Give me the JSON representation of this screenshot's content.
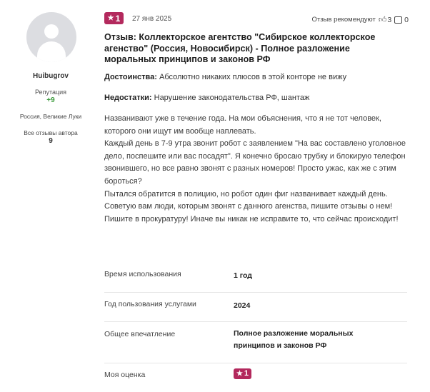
{
  "author": {
    "name": "Huibugrov",
    "reputation_label": "Репутация",
    "reputation_value": "+9",
    "location": "Россия, Великие Луки",
    "all_reviews_label": "Все отзывы автора",
    "all_reviews_count": "9"
  },
  "review": {
    "rating": "1",
    "date": "27 янв 2025",
    "recommend_label": "Отзыв рекомендуют",
    "likes": "3",
    "comments": "0",
    "title": "Отзыв: Коллекторское агентство \"Сибирское коллекторское агенство\" (Россия, Новосибирск) - Полное разложение моральных принципов и законов РФ",
    "pros_label": "Достоинства:",
    "pros_text": "Абсолютно никаких плюсов в этой конторе не вижу",
    "cons_label": "Недостатки:",
    "cons_text": "Нарушение законодательства РФ, шантаж",
    "paragraphs": [
      "Названивают уже в течение года. На мои объяснения, что я не тот человек, которого они ищут им вообще наплевать.",
      "Каждый день в 7-9 утра звонит робот с заявлением \"На вас составлено уголовное дело, поспешите или вас посадят\". Я конечно бросаю трубку и блокирую телефон звонившего, но все равно звонят с разных номеров! Просто ужас, как же с этим бороться?",
      "Пытался обратится в полицию, но робот один фиг названивает каждый день.",
      "Советую вам люди, которым звонят с данного агенства, пишите отзывы о нем! Пишите в прокуратуру! Иначе вы никак не исправите то, что сейчас происходит!"
    ]
  },
  "details": {
    "usage_label": "Время использования",
    "usage_value": "1 год",
    "year_label": "Год пользования услугами",
    "year_value": "2024",
    "impression_label": "Общее впечатление",
    "impression_value": "Полное разложение моральных принципов и законов РФ",
    "my_rating_label": "Моя оценка",
    "my_rating_value": "1"
  },
  "colors": {
    "badge": "#b3295d",
    "reputation": "#3a9a3a"
  },
  "icons": [
    "avatar-placeholder-icon",
    "star-icon",
    "thumbs-up-icon",
    "comment-icon"
  ]
}
